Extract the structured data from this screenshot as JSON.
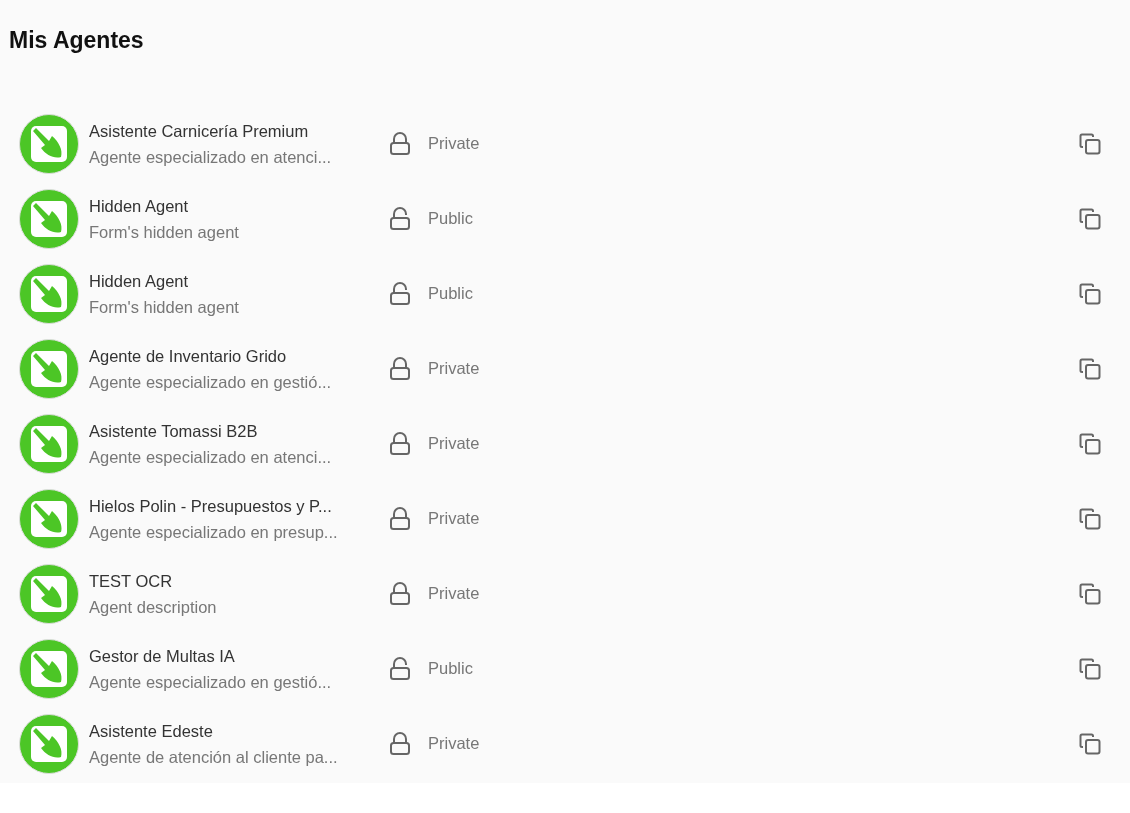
{
  "title": "Mis Agentes",
  "agents": [
    {
      "name": "Asistente Carnicería Premium",
      "description": "Agente especializado en atenci...",
      "visibility": "Private",
      "locked": true
    },
    {
      "name": "Hidden Agent",
      "description": "Form's hidden agent",
      "visibility": "Public",
      "locked": false
    },
    {
      "name": "Hidden Agent",
      "description": "Form's hidden agent",
      "visibility": "Public",
      "locked": false
    },
    {
      "name": "Agente de Inventario Grido",
      "description": "Agente especializado en gestió...",
      "visibility": "Private",
      "locked": true
    },
    {
      "name": "Asistente Tomassi B2B",
      "description": "Agente especializado en atenci...",
      "visibility": "Private",
      "locked": true
    },
    {
      "name": "Hielos Polin - Presupuestos y P...",
      "description": "Agente especializado en presup...",
      "visibility": "Private",
      "locked": true
    },
    {
      "name": "TEST OCR",
      "description": "Agent description",
      "visibility": "Private",
      "locked": true
    },
    {
      "name": "Gestor de Multas IA",
      "description": "Agente especializado en gestió...",
      "visibility": "Public",
      "locked": false
    },
    {
      "name": "Asistente Edeste",
      "description": "Agente de atención al cliente pa...",
      "visibility": "Private",
      "locked": true
    }
  ]
}
